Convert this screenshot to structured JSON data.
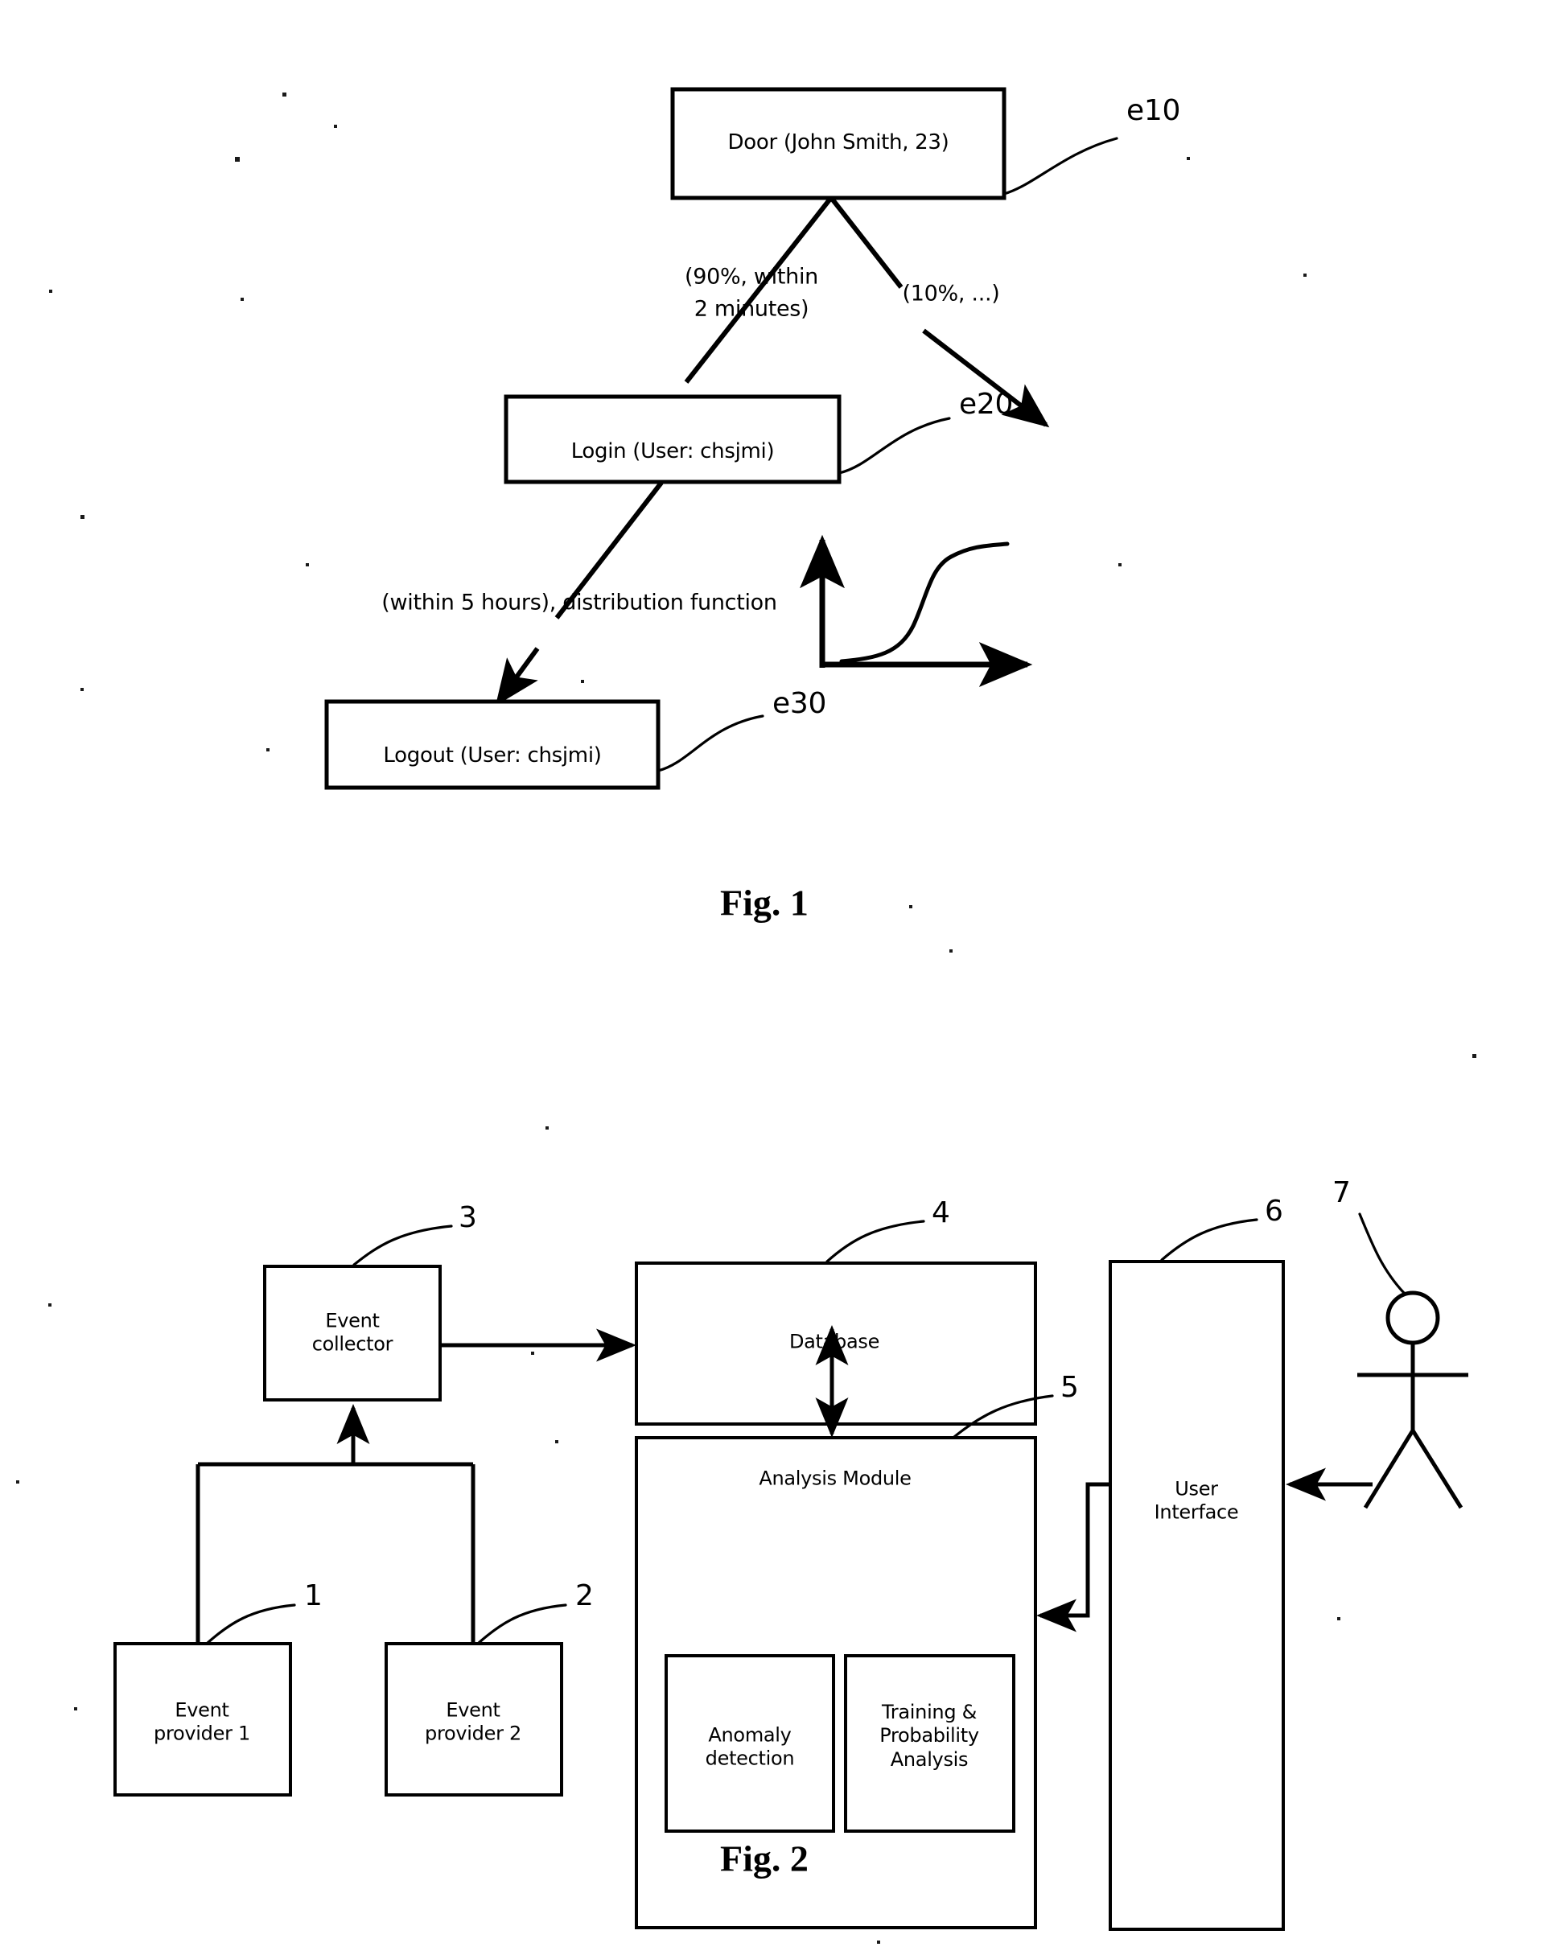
{
  "figure1": {
    "caption": "Fig. 1",
    "nodes": [
      {
        "id": "e10",
        "label": "Door (John Smith, 23)",
        "ref": "e10"
      },
      {
        "id": "e20",
        "label": "Login (User: chsjmi)",
        "ref": "e20"
      },
      {
        "id": "e30",
        "label": "Logout (User: chsjmi)",
        "ref": "e30"
      }
    ],
    "edges": [
      {
        "id": "edge-door-login",
        "line1": "(90%, within",
        "line2": "2 minutes)"
      },
      {
        "id": "edge-door-other",
        "line1": "(10%, ...)"
      },
      {
        "id": "edge-login-logout",
        "line1": "(within 5 hours), distribution function"
      }
    ],
    "plot": {
      "name": "distribution-function-plot",
      "curve_type": "sigmoid",
      "x_axis_label": "",
      "y_axis_label": ""
    }
  },
  "figure2": {
    "caption": "Fig. 2",
    "nodes": [
      {
        "id": "event-provider-1",
        "label": "Event\nprovider 1",
        "ref": "1"
      },
      {
        "id": "event-provider-2",
        "label": "Event\nprovider 2",
        "ref": "2"
      },
      {
        "id": "event-collector",
        "label": "Event\ncollector",
        "ref": "3"
      },
      {
        "id": "database",
        "label": "Database",
        "ref": "4"
      },
      {
        "id": "analysis-module",
        "label": "Analysis Module",
        "ref": "5"
      },
      {
        "id": "anomaly-detection",
        "label": "Anomaly\ndetection",
        "ref": ""
      },
      {
        "id": "training-probability",
        "label": "Training &\nProbability\nAnalysis",
        "ref": ""
      },
      {
        "id": "user-interface",
        "label": "User\nInterface",
        "ref": "6"
      },
      {
        "id": "user-actor",
        "label": "",
        "ref": "7"
      }
    ]
  },
  "colors": {
    "ink": "#000000",
    "paper": "#ffffff"
  }
}
